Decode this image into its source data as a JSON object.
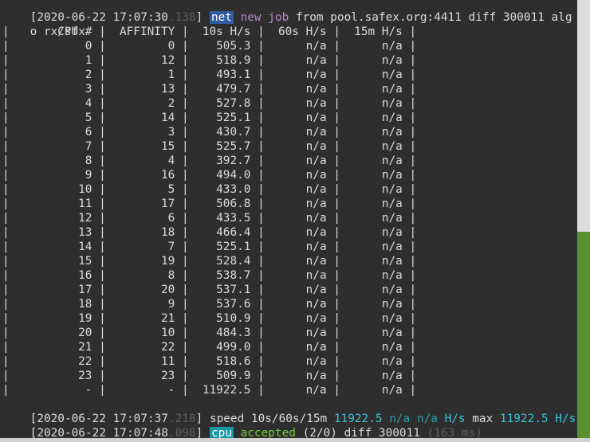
{
  "line1": {
    "timestamp": "[2020-06-22 17:07:30",
    "ms": ".138",
    "bracket": "]",
    "tag": "net",
    "msg_job": "new job",
    "msg_from": "from pool.safex.org:4411 diff 300011 alg"
  },
  "line2": {
    "text": "o rx/sfx"
  },
  "table": {
    "headers": [
      "CPU #",
      "AFFINITY",
      "10s H/s",
      "60s H/s",
      "15m H/s"
    ],
    "rows": [
      [
        "0",
        "0",
        "505.3",
        "n/a",
        "n/a"
      ],
      [
        "1",
        "12",
        "518.9",
        "n/a",
        "n/a"
      ],
      [
        "2",
        "1",
        "493.1",
        "n/a",
        "n/a"
      ],
      [
        "3",
        "13",
        "479.7",
        "n/a",
        "n/a"
      ],
      [
        "4",
        "2",
        "527.8",
        "n/a",
        "n/a"
      ],
      [
        "5",
        "14",
        "525.1",
        "n/a",
        "n/a"
      ],
      [
        "6",
        "3",
        "430.7",
        "n/a",
        "n/a"
      ],
      [
        "7",
        "15",
        "525.7",
        "n/a",
        "n/a"
      ],
      [
        "8",
        "4",
        "392.7",
        "n/a",
        "n/a"
      ],
      [
        "9",
        "16",
        "494.0",
        "n/a",
        "n/a"
      ],
      [
        "10",
        "5",
        "433.0",
        "n/a",
        "n/a"
      ],
      [
        "11",
        "17",
        "506.8",
        "n/a",
        "n/a"
      ],
      [
        "12",
        "6",
        "433.5",
        "n/a",
        "n/a"
      ],
      [
        "13",
        "18",
        "466.4",
        "n/a",
        "n/a"
      ],
      [
        "14",
        "7",
        "525.1",
        "n/a",
        "n/a"
      ],
      [
        "15",
        "19",
        "528.4",
        "n/a",
        "n/a"
      ],
      [
        "16",
        "8",
        "538.7",
        "n/a",
        "n/a"
      ],
      [
        "17",
        "20",
        "537.1",
        "n/a",
        "n/a"
      ],
      [
        "18",
        "9",
        "537.6",
        "n/a",
        "n/a"
      ],
      [
        "19",
        "21",
        "510.9",
        "n/a",
        "n/a"
      ],
      [
        "20",
        "10",
        "484.3",
        "n/a",
        "n/a"
      ],
      [
        "21",
        "22",
        "499.0",
        "n/a",
        "n/a"
      ],
      [
        "22",
        "11",
        "518.6",
        "n/a",
        "n/a"
      ],
      [
        "23",
        "23",
        "509.9",
        "n/a",
        "n/a"
      ],
      [
        "-",
        "-",
        "11922.5",
        "n/a",
        "n/a"
      ]
    ]
  },
  "speed_line": {
    "timestamp": "[2020-06-22 17:07:37",
    "ms": ".218",
    "bracket": "]",
    "label": "speed 10s/60s/15m",
    "v10": "11922.5",
    "v60": "n/a",
    "v15": "n/a",
    "unit": "H/s",
    "max_label": "max",
    "max_value": "11922.5",
    "max_unit": "H/s"
  },
  "cpu_line": {
    "timestamp": "[2020-06-22 17:07:48",
    "ms": ".098",
    "bracket": "]",
    "tag": "cpu",
    "accepted": "accepted",
    "count": "(2/0)",
    "diff": "diff 300011",
    "latency": "(163 ms)"
  },
  "colors": {
    "background": "#2e2e2e",
    "net_badge": "#2f5c9e",
    "cpu_badge": "#1897a6",
    "accepted": "#7ccd38",
    "speed_value": "#3cc3d8",
    "job_text": "#b58ec9",
    "scrollbar_thumb": "#5a8f2e"
  }
}
